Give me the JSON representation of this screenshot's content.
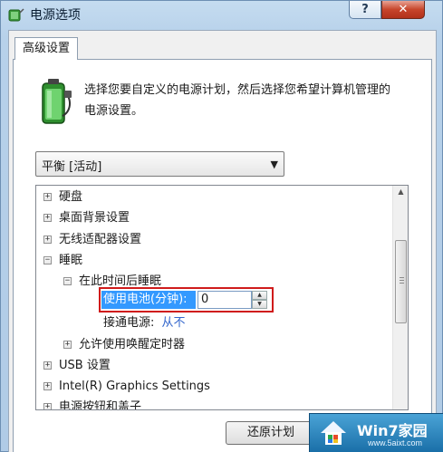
{
  "window": {
    "title": "电源选项",
    "help_label": "?",
    "close_label": "✕"
  },
  "tab": {
    "label": "高级设置"
  },
  "description": "选择您要自定义的电源计划，然后选择您希望计算机管理的电源设置。",
  "plan_select": {
    "value": "平衡 [活动]"
  },
  "tree": {
    "items": [
      {
        "label": "硬盘",
        "expander": "+"
      },
      {
        "label": "桌面背景设置",
        "expander": "+"
      },
      {
        "label": "无线适配器设置",
        "expander": "+"
      },
      {
        "label": "睡眠",
        "expander": "−"
      },
      {
        "label": "在此时间后睡眠",
        "expander": "−"
      },
      {
        "label": "使用电池(分钟):",
        "value": "0"
      },
      {
        "label": "接通电源:",
        "value": "从不"
      },
      {
        "label": "允许使用唤醒定时器",
        "expander": "+"
      },
      {
        "label": "USB 设置",
        "expander": "+"
      },
      {
        "label": "Intel(R) Graphics Settings",
        "expander": "+"
      },
      {
        "label": "电源按钮和盖子",
        "expander": "+"
      }
    ]
  },
  "buttons": {
    "restore": "还原计划"
  },
  "watermark": {
    "title": "Win7家园",
    "url": "www.5aixt.com"
  },
  "colors": {
    "highlight": "#3399ff",
    "red_box": "#d01b1b",
    "link_blue": "#3366cc"
  }
}
